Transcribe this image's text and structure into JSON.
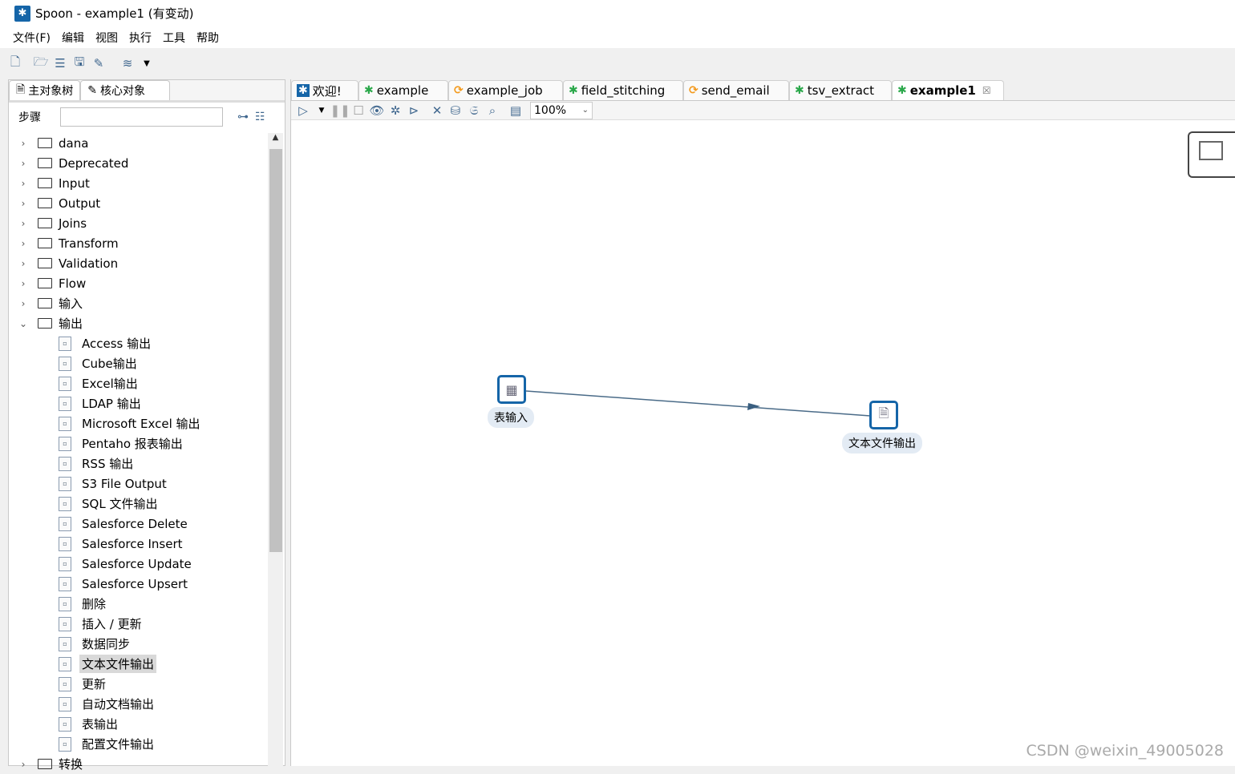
{
  "window": {
    "title": "Spoon - example1 (有变动)"
  },
  "menu": [
    "文件(F)",
    "编辑",
    "视图",
    "执行",
    "工具",
    "帮助"
  ],
  "left": {
    "tabs": [
      "主对象树",
      "核心对象"
    ],
    "steps_label": "步骤",
    "search_value": "",
    "folders_top": [
      "dana",
      "Deprecated",
      "Input",
      "Output",
      "Joins",
      "Transform",
      "Validation",
      "Flow",
      "输入"
    ],
    "open_folder": "输出",
    "leaves": [
      "Access 输出",
      "Cube输出",
      "Excel输出",
      "LDAP 输出",
      "Microsoft Excel 输出",
      "Pentaho 报表输出",
      "RSS 输出",
      "S3 File Output",
      "SQL 文件输出",
      "Salesforce Delete",
      "Salesforce Insert",
      "Salesforce Update",
      "Salesforce Upsert",
      "删除",
      "插入 / 更新",
      "数据同步",
      "文本文件输出",
      "更新",
      "自动文档输出",
      "表输出",
      "配置文件输出"
    ],
    "selected_leaf": "文本文件输出",
    "folders_bottom": [
      "转换"
    ]
  },
  "tabs": [
    {
      "label": "欢迎!",
      "icon": "spoon-icon"
    },
    {
      "label": "example",
      "icon": "transformation-icon"
    },
    {
      "label": "example_job",
      "icon": "job-icon"
    },
    {
      "label": "field_stitching",
      "icon": "transformation-icon"
    },
    {
      "label": "send_email",
      "icon": "job-icon"
    },
    {
      "label": "tsv_extract",
      "icon": "transformation-icon"
    },
    {
      "label": "example1",
      "icon": "transformation-icon",
      "active": true
    }
  ],
  "canvas": {
    "zoom": "100%",
    "steps": [
      {
        "label": "表输入"
      },
      {
        "label": "文本文件输出"
      }
    ]
  },
  "colors": {
    "accent": "#1565a8",
    "transformation": "#2aa84a",
    "job": "#f39a1e"
  },
  "watermark": "CSDN @weixin_49005028"
}
